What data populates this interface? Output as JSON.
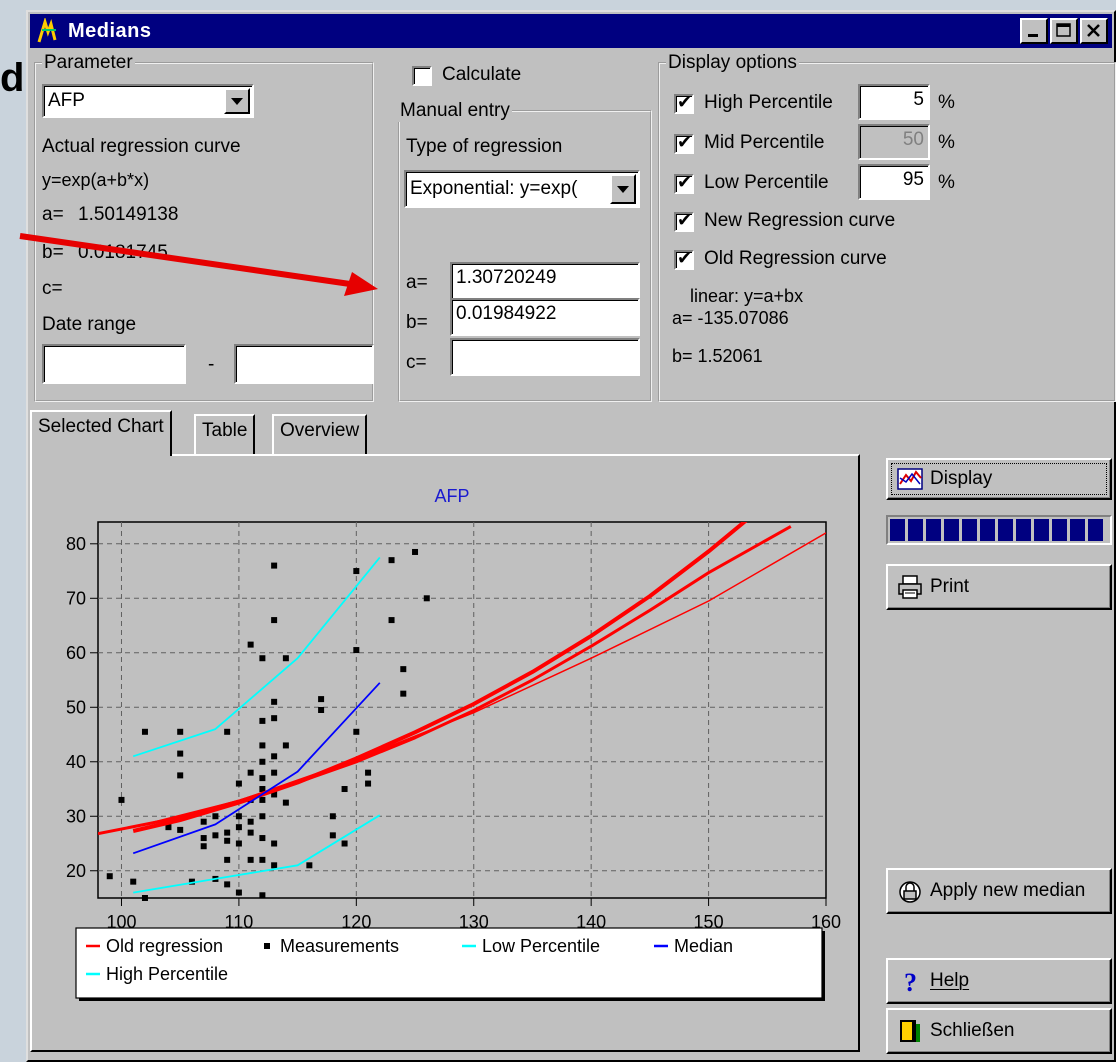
{
  "background": {
    "partial_text": "d"
  },
  "window": {
    "title": "Medians"
  },
  "parameter": {
    "group_label": "Parameter",
    "selected": "AFP",
    "curve_heading": "Actual regression curve",
    "formula": "y=exp(a+b*x)",
    "a_label": "a=",
    "a_value": "1.50149138",
    "b_label": "b=",
    "b_value": "0.0181745",
    "c_label": "c=",
    "date_range_label": "Date range",
    "date_from": "",
    "date_separator": "-",
    "date_to": ""
  },
  "manual": {
    "calculate_label": "Calculate",
    "calculate_checked": false,
    "group_label": "Manual entry",
    "type_label": "Type of regression",
    "type_selected": "Exponential: y=exp(",
    "a_label": "a=",
    "a_value": "1.30720249",
    "b_label": "b=",
    "b_value": "0.01984922",
    "c_label": "c=",
    "c_value": ""
  },
  "display_options": {
    "group_label": "Display options",
    "high_label": "High Percentile",
    "high_checked": true,
    "high_value": "5",
    "mid_label": "Mid Percentile",
    "mid_checked": true,
    "mid_value": "50",
    "low_label": "Low Percentile",
    "low_checked": true,
    "low_value": "95",
    "percent_sign": "%",
    "new_curve_label": "New Regression curve",
    "new_curve_checked": true,
    "old_curve_label": "Old Regression curve",
    "old_curve_checked": true,
    "linear_formula": "linear: y=a+bx",
    "linear_a": "a= -135.07086",
    "linear_b": "b= 1.52061"
  },
  "tabs": [
    {
      "label": "Selected Chart",
      "active": true
    },
    {
      "label": "Table",
      "active": false
    },
    {
      "label": "Overview",
      "active": false
    }
  ],
  "buttons": {
    "display": "Display",
    "print": "Print",
    "apply": "Apply new median",
    "help": "Help",
    "close": "Schließen"
  },
  "progress": {
    "fraction": 1.0,
    "blocks": 12
  },
  "colors": {
    "old_regression": "#ff0000",
    "measurements": "#000000",
    "percentile": "#00ffff",
    "median": "#0000ff",
    "annotation_arrow": "#e60000"
  },
  "chart_data": {
    "type": "scatter",
    "title": "AFP",
    "xlabel": "",
    "ylabel": "",
    "xlim": [
      98,
      160
    ],
    "ylim": [
      15,
      84
    ],
    "x_ticks": [
      100,
      110,
      120,
      130,
      140,
      150,
      160
    ],
    "y_ticks": [
      20,
      30,
      40,
      50,
      60,
      70,
      80
    ],
    "grid": true,
    "legend_position": "bottom",
    "legend": [
      "Old regression",
      "Measurements",
      "Low Percentile",
      "Median",
      "High Percentile"
    ],
    "series": [
      {
        "name": "Measurements",
        "kind": "points",
        "points": [
          [
            100,
            33
          ],
          [
            99,
            19
          ],
          [
            101,
            18
          ],
          [
            102,
            45.5
          ],
          [
            102,
            15
          ],
          [
            104,
            28
          ],
          [
            105,
            27.5
          ],
          [
            105,
            37.5
          ],
          [
            105,
            41.5
          ],
          [
            105,
            45.5
          ],
          [
            106,
            18
          ],
          [
            107,
            24.5
          ],
          [
            107,
            26
          ],
          [
            107,
            29
          ],
          [
            108,
            18.5
          ],
          [
            108,
            26.5
          ],
          [
            108,
            30
          ],
          [
            109,
            17.5
          ],
          [
            109,
            22
          ],
          [
            109,
            25.5
          ],
          [
            109,
            27
          ],
          [
            109,
            45.5
          ],
          [
            110,
            25
          ],
          [
            110,
            28
          ],
          [
            110,
            30
          ],
          [
            110,
            36
          ],
          [
            110,
            16
          ],
          [
            111,
            22
          ],
          [
            111,
            27
          ],
          [
            111,
            29
          ],
          [
            111,
            33
          ],
          [
            111,
            38
          ],
          [
            111,
            61.5
          ],
          [
            112,
            15.5
          ],
          [
            112,
            22
          ],
          [
            112,
            26
          ],
          [
            112,
            30
          ],
          [
            112,
            33
          ],
          [
            112,
            35
          ],
          [
            112,
            37
          ],
          [
            112,
            40
          ],
          [
            112,
            43
          ],
          [
            112,
            47.5
          ],
          [
            112,
            59
          ],
          [
            113,
            21
          ],
          [
            113,
            25
          ],
          [
            113,
            34
          ],
          [
            113,
            38
          ],
          [
            113,
            41
          ],
          [
            113,
            48
          ],
          [
            113,
            51
          ],
          [
            113,
            66
          ],
          [
            113,
            76
          ],
          [
            114,
            32.5
          ],
          [
            114,
            43
          ],
          [
            114,
            59
          ],
          [
            116,
            21
          ],
          [
            117,
            49.5
          ],
          [
            117,
            51.5
          ],
          [
            118,
            26.5
          ],
          [
            118,
            30
          ],
          [
            119,
            25
          ],
          [
            119,
            35
          ],
          [
            120,
            45.5
          ],
          [
            120,
            75
          ],
          [
            120,
            60.5
          ],
          [
            121,
            36
          ],
          [
            121,
            38
          ],
          [
            123,
            66
          ],
          [
            123,
            77
          ],
          [
            124,
            52.5
          ],
          [
            124,
            57
          ],
          [
            125,
            78.5
          ],
          [
            126,
            70
          ]
        ]
      },
      {
        "name": "Old regression",
        "kind": "line",
        "points": [
          [
            101,
            27.3
          ],
          [
            105,
            29.3
          ],
          [
            110,
            32.5
          ],
          [
            115,
            36.2
          ],
          [
            120,
            40.6
          ],
          [
            125,
            45.4
          ],
          [
            130,
            50.6
          ],
          [
            135,
            56.5
          ],
          [
            140,
            63.1
          ],
          [
            145,
            70.4
          ],
          [
            150,
            78.6
          ],
          [
            154,
            85.7
          ]
        ]
      },
      {
        "name": "New regression",
        "kind": "line",
        "points": [
          [
            98,
            26.8
          ],
          [
            105,
            29.8
          ],
          [
            110,
            32.8
          ],
          [
            115,
            36.2
          ],
          [
            120,
            40
          ],
          [
            125,
            44.4
          ],
          [
            130,
            49.4
          ],
          [
            135,
            55
          ],
          [
            140,
            61.2
          ],
          [
            145,
            67.8
          ],
          [
            150,
            74.7
          ],
          [
            157,
            83.2
          ]
        ]
      },
      {
        "name": "Old regression (thin)",
        "kind": "line",
        "points": [
          [
            101,
            28
          ],
          [
            110,
            32.9
          ],
          [
            120,
            40.4
          ],
          [
            130,
            49
          ],
          [
            140,
            59
          ],
          [
            150,
            69.5
          ],
          [
            160,
            82
          ]
        ]
      },
      {
        "name": "Low Percentile",
        "kind": "line",
        "points": [
          [
            101,
            16
          ],
          [
            108,
            18.5
          ],
          [
            115,
            21
          ],
          [
            122,
            30.2
          ]
        ]
      },
      {
        "name": "Median",
        "kind": "line",
        "points": [
          [
            101,
            23.2
          ],
          [
            108,
            28.5
          ],
          [
            115,
            38.2
          ],
          [
            122,
            54.5
          ]
        ]
      },
      {
        "name": "High Percentile",
        "kind": "line",
        "points": [
          [
            101,
            41
          ],
          [
            108,
            46
          ],
          [
            115,
            59
          ],
          [
            122,
            77.5
          ]
        ]
      }
    ]
  }
}
